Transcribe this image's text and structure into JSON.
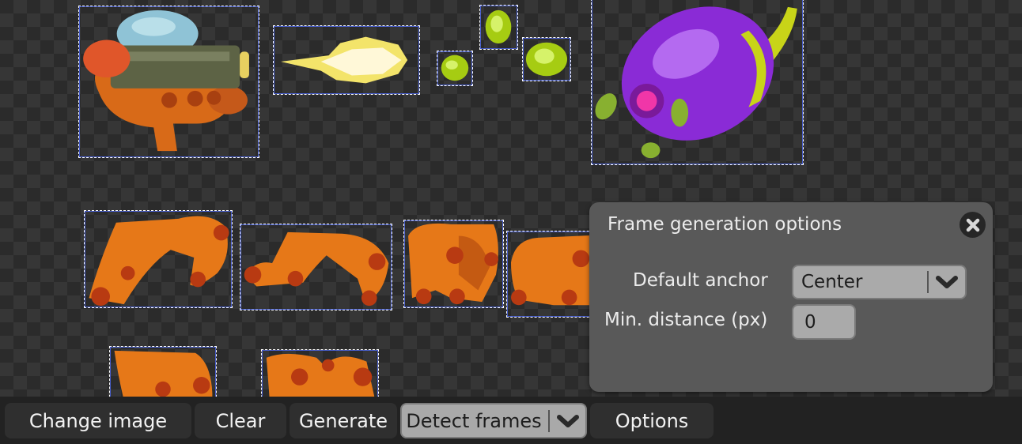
{
  "toolbar": {
    "change_image": "Change image",
    "clear": "Clear",
    "generate": "Generate",
    "detect_frames": "Detect frames",
    "options": "Options"
  },
  "options_panel": {
    "title": "Frame generation options",
    "default_anchor_label": "Default anchor",
    "default_anchor_value": "Center",
    "min_distance_label": "Min. distance (px)",
    "min_distance_value": "0"
  },
  "icons": {
    "close": "close-circle-icon",
    "dropdown": "chevron-down-icon"
  },
  "colors": {
    "canvas_dark": "#2b2b2b",
    "canvas_light": "#363636",
    "frame_border": "#ffffff",
    "frame_outline": "#5070ff",
    "panel_bg": "#595959",
    "button_bg": "#2f2f2f",
    "button_active_bg": "#a9a9a9",
    "sprite_orange": "#e87820",
    "sprite_purple": "#9a38e0",
    "sprite_green": "#b8e020"
  }
}
